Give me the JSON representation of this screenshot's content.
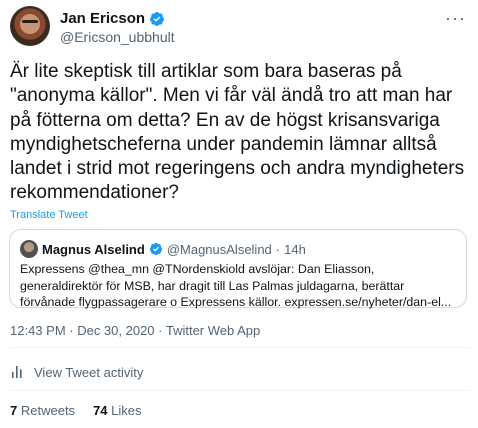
{
  "author": {
    "name": "Jan Ericson",
    "handle": "@Ericson_ubbhult",
    "more_icon": "more-horizontal-icon"
  },
  "tweet": {
    "text": "Är lite skeptisk till artiklar som bara baseras på \"anonyma källor\". Men vi får väl ändå tro att man har på fötterna om detta? En av de högst krisansvariga myndighetscheferna under pandemin lämnar alltså landet i strid mot regeringens och andra myndigheters rekommendationer?",
    "translate_label": "Translate Tweet"
  },
  "quote": {
    "name": "Magnus Alselind",
    "handle": "@MagnusAlselind",
    "separator": "·",
    "age": "14h",
    "text": "Expressens @thea_mn @TNordenskiold avslöjar: Dan Eliasson, generaldirektör för MSB, har dragit till Las Palmas juldagarna, berättar förvånade flygpassagerare o Expressens källor. expressen.se/nyheter/dan-el..."
  },
  "meta": {
    "time": "12:43 PM",
    "date": "Dec 30, 2020",
    "source": "Twitter Web App",
    "line": "12:43 PM · Dec 30, 2020 · Twitter Web App"
  },
  "activity": {
    "label": "View Tweet activity",
    "icon": "bar-chart-icon"
  },
  "stats": {
    "retweets_count": "7",
    "retweets_label": "Retweets",
    "likes_count": "74",
    "likes_label": "Likes"
  },
  "colors": {
    "accent": "#1d9bf0",
    "text": "#0f1419",
    "secondary": "#536471",
    "border": "#cfd9de"
  }
}
